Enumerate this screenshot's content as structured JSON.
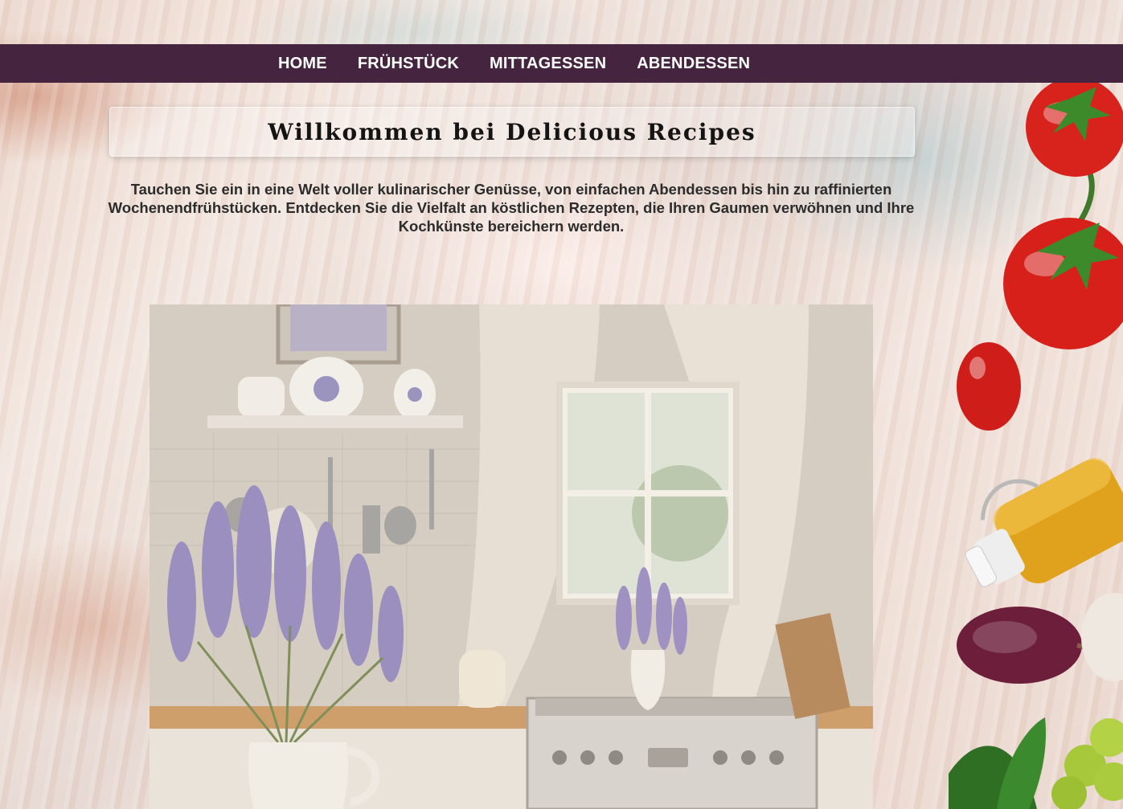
{
  "nav": {
    "items": [
      {
        "label": "HOME"
      },
      {
        "label": "FRÜHSTÜCK"
      },
      {
        "label": "MITTAGESSEN"
      },
      {
        "label": "ABENDESSEN"
      }
    ]
  },
  "header": {
    "title": "Willkommen bei Delicious Recipes"
  },
  "intro": {
    "text": "Tauchen Sie ein in eine Welt voller kulinarischer Genüsse, von einfachen Abendessen bis hin zu raffinierten Wochenendfrühstücken. Entdecken Sie die Vielfalt an köstlichen Rezepten, die Ihren Gaumen verwöhnen und Ihre Kochkünste bereichern werden."
  },
  "colors": {
    "nav_background": "#45243f",
    "nav_text": "#ffffff",
    "title_text": "#141414",
    "body_text": "#2c2c2c"
  },
  "images": {
    "hero": "kitchen-lavender-illustration",
    "background": "painted-texture-with-tomatoes-oil-onion-garlic"
  }
}
